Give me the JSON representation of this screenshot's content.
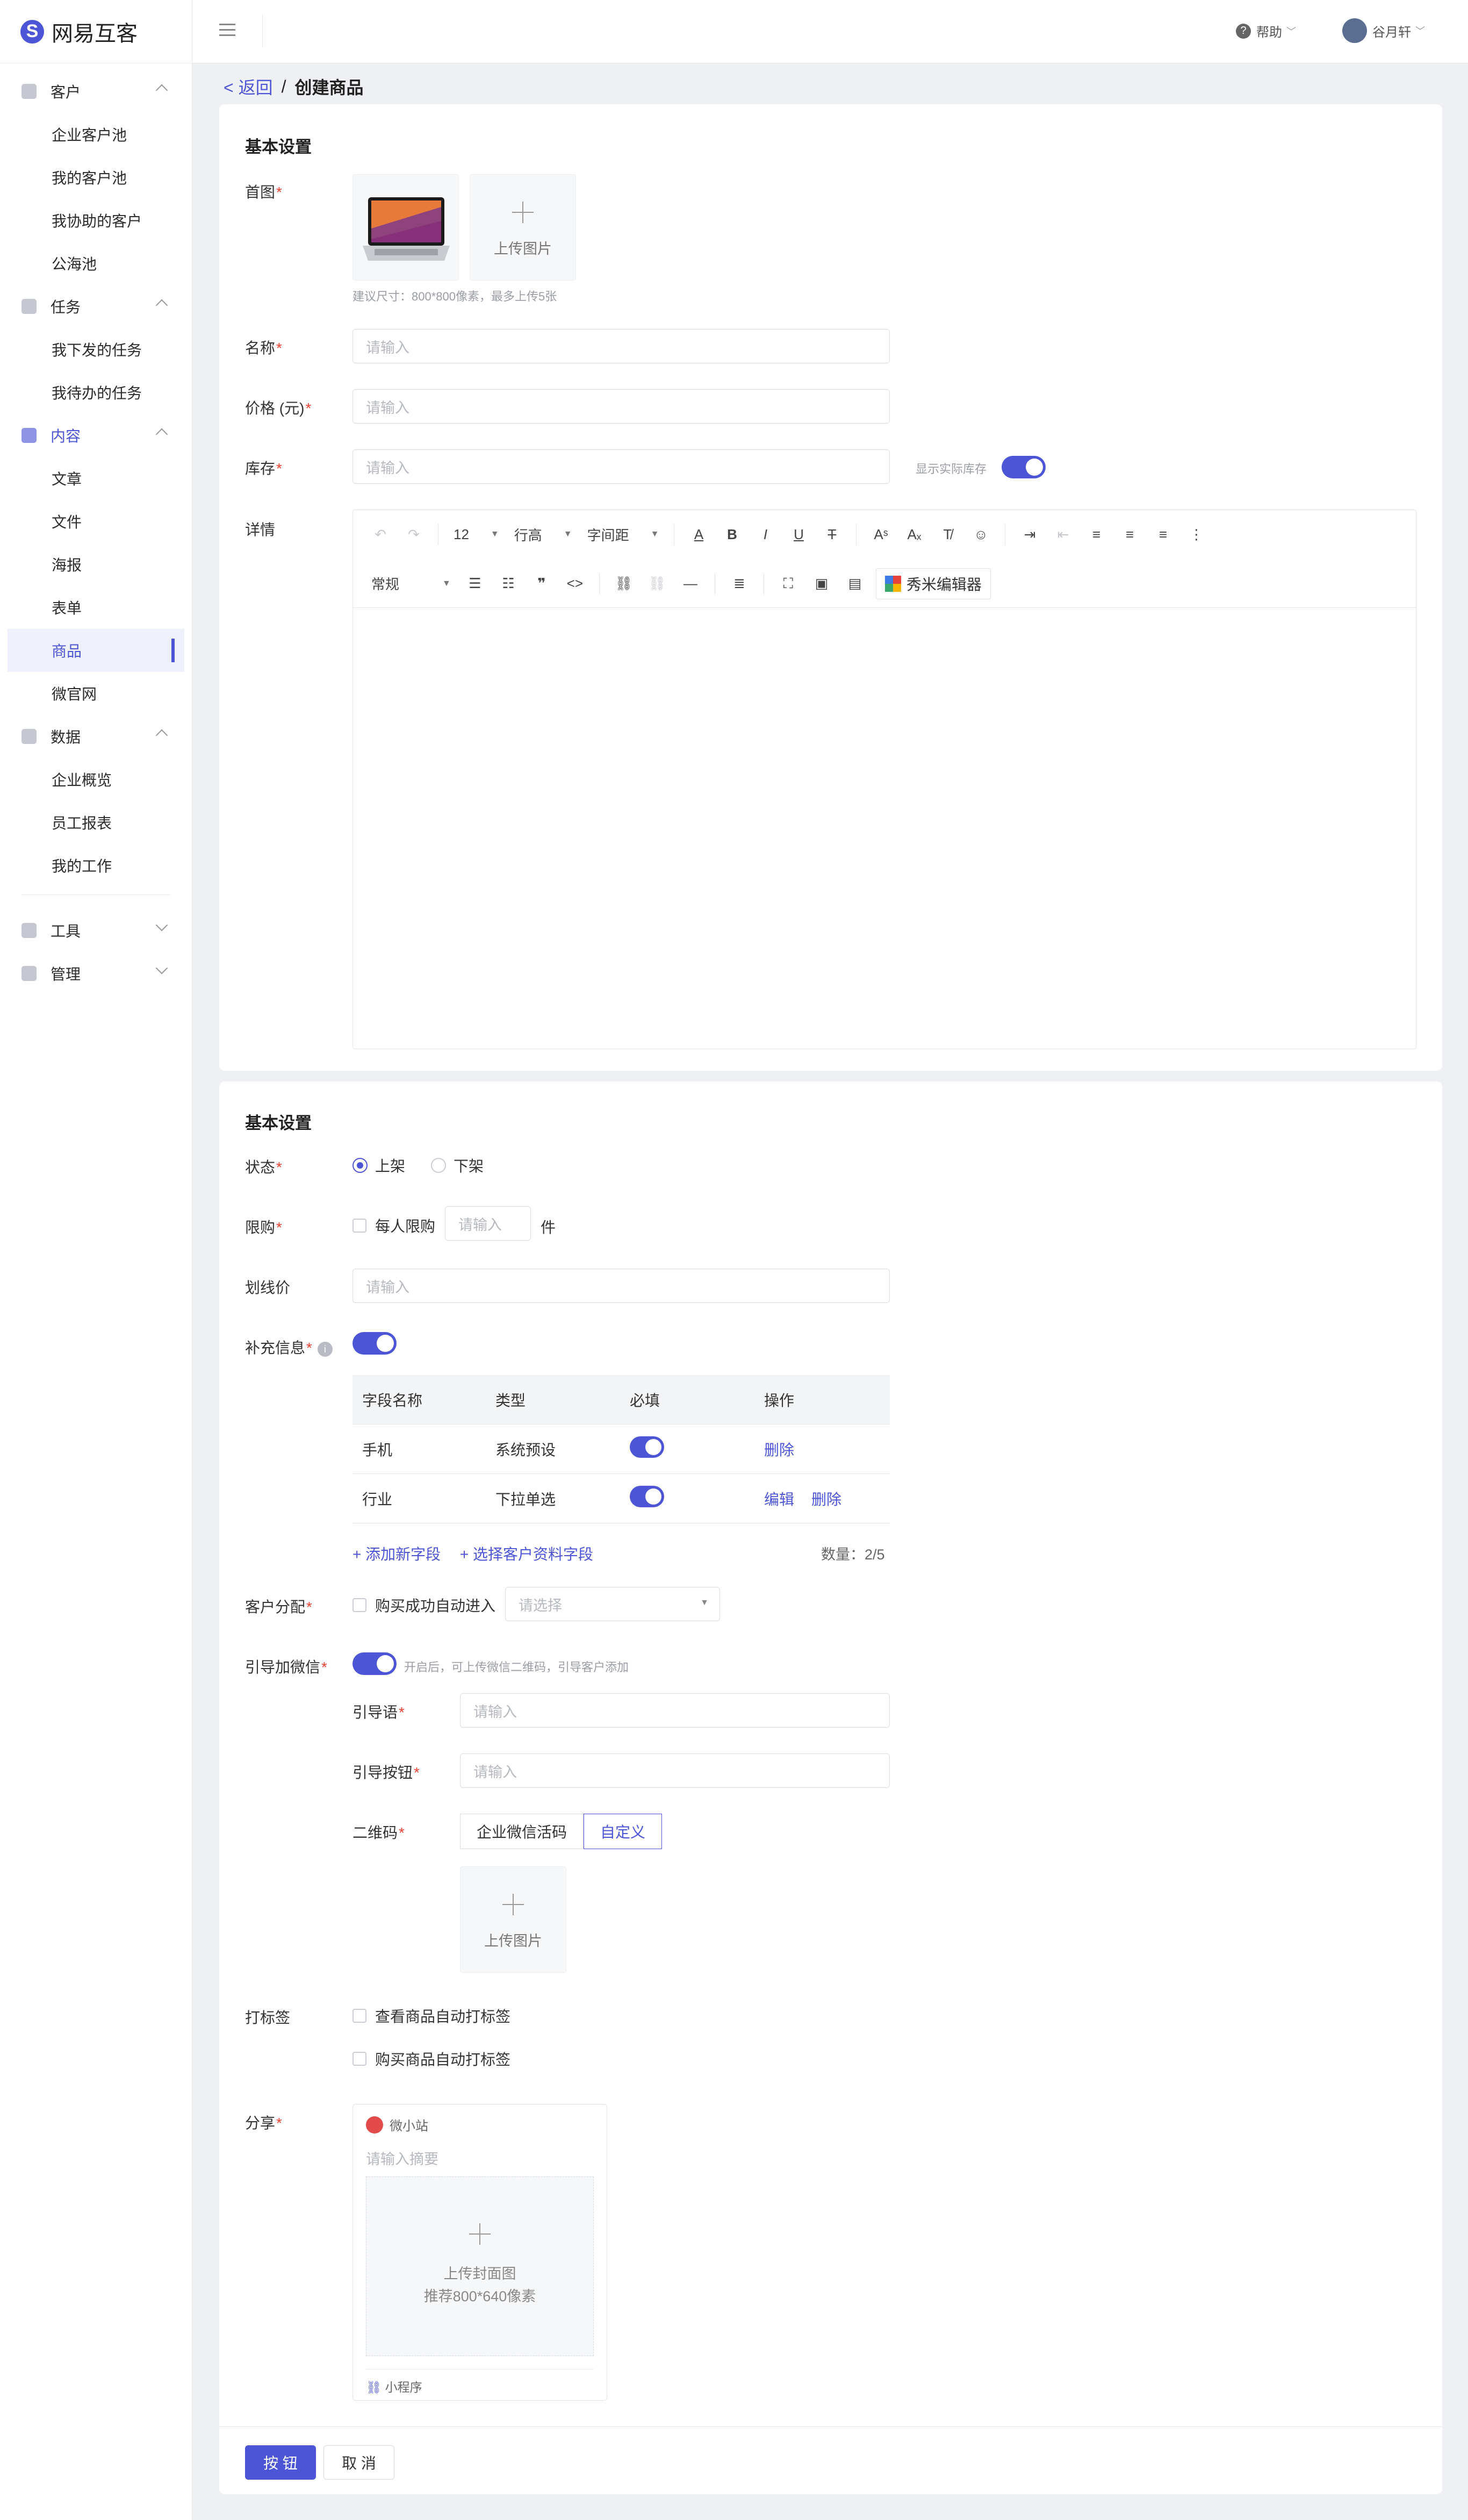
{
  "app": {
    "name": "网易互客"
  },
  "sidebar": {
    "groups": [
      {
        "label": "客户",
        "items": [
          "企业客户池",
          "我的客户池",
          "我协助的客户",
          "公海池"
        ]
      },
      {
        "label": "任务",
        "items": [
          "我下发的任务",
          "我待办的任务"
        ]
      },
      {
        "label": "内容",
        "items": [
          "文章",
          "文件",
          "海报",
          "表单",
          "商品",
          "微官网"
        ]
      },
      {
        "label": "数据",
        "items": [
          "企业概览",
          "员工报表",
          "我的工作"
        ]
      },
      {
        "label": "工具",
        "items": []
      },
      {
        "label": "管理",
        "items": []
      }
    ],
    "selected": "商品"
  },
  "topbar": {
    "help": "帮助",
    "user": "谷月轩"
  },
  "breadcrumb": {
    "back": "返回",
    "sep": "/",
    "current": "创建商品"
  },
  "section1": {
    "title": "基本设置",
    "cover_label": "首图",
    "upload_label": "上传图片",
    "upload_hint": "建议尺寸：800*800像素，最多上传5张",
    "name_label": "名称",
    "price_label": "价格 (元)",
    "stock_label": "库存",
    "placeholder": "请输入",
    "show_stock": "显示实际库存",
    "detail_label": "详情",
    "toolbar": {
      "font_size": "12",
      "line_height": "行高",
      "letter_spacing": "字间距",
      "para": "常规",
      "xiumi": "秀米编辑器"
    }
  },
  "section2": {
    "title": "基本设置",
    "status_label": "状态",
    "status_on": "上架",
    "status_off": "下架",
    "limit_label": "限购",
    "limit_each": "每人限购",
    "limit_placeholder": "请输入",
    "limit_unit": "件",
    "strike_label": "划线价",
    "placeholder": "请输入",
    "extra_label": "补充信息",
    "table": {
      "headers": [
        "字段名称",
        "类型",
        "必填",
        "操作"
      ],
      "rows": [
        {
          "name": "手机",
          "type": "系统预设",
          "actions": [
            "删除"
          ]
        },
        {
          "name": "行业",
          "type": "下拉单选",
          "actions": [
            "编辑",
            "删除"
          ]
        }
      ]
    },
    "add_field": "+ 添加新字段",
    "choose_field": "+ 选择客户资料字段",
    "count": "数量：2/5",
    "assign_label": "客户分配",
    "assign_check": "购买成功自动进入",
    "assign_placeholder": "请选择",
    "wechat_label": "引导加微信",
    "wechat_hint": "开启后，可上传微信二维码，引导客户添加",
    "guide_text_label": "引导语",
    "guide_btn_label": "引导按钮",
    "qr_label": "二维码",
    "qr_tabs": [
      "企业微信活码",
      "自定义"
    ],
    "upload_label": "上传图片",
    "tag_label": "打标签",
    "tag_view": "查看商品自动打标签",
    "tag_buy": "购买商品自动打标签",
    "share_label": "分享",
    "share_site": "微小站",
    "share_placeholder": "请输入摘要",
    "share_cover1": "上传封面图",
    "share_cover2": "推荐800*640像素",
    "share_mini": "小程序",
    "btn_ok": "按 钮",
    "btn_cancel": "取 消"
  }
}
